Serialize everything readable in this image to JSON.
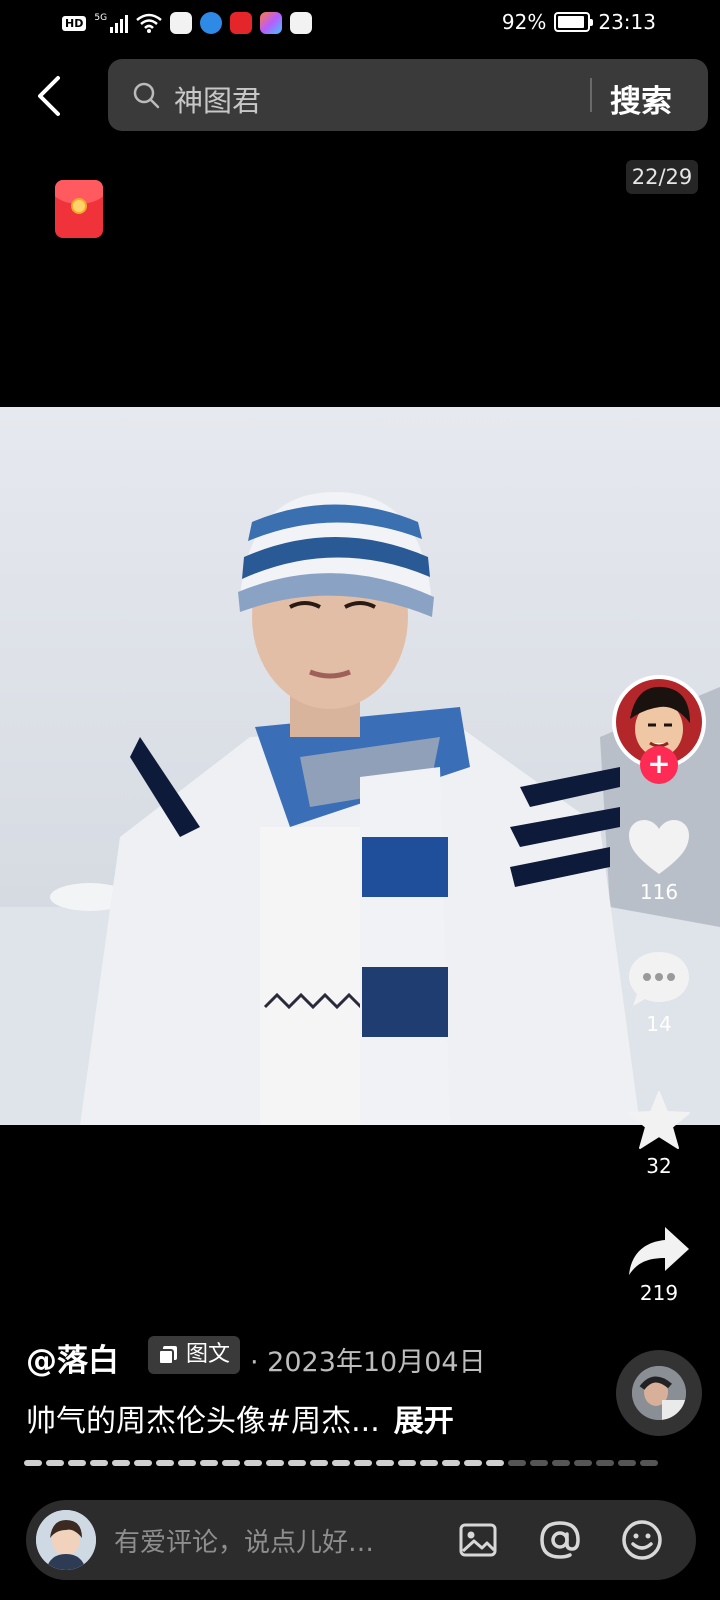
{
  "status_bar": {
    "left_badges": [
      "HD",
      "5G"
    ],
    "battery": "92%",
    "battery_level": 0.92,
    "time": "23:13"
  },
  "header": {
    "back_icon": "chevron-left-icon",
    "search_query": "神图君",
    "search_button": "搜索"
  },
  "image_counter": "22/29",
  "actions": {
    "likes": "116",
    "comments": "14",
    "favorites": "32",
    "shares": "219"
  },
  "post": {
    "author": "@落白",
    "type_tag": "图文",
    "date": "· 2023年10月04日",
    "caption": "帅气的周杰伦头像#周杰...",
    "expand": "展开"
  },
  "comment_bar": {
    "placeholder": "有爱评论，说点儿好…",
    "icons": [
      "image-icon",
      "at-icon",
      "emoji-icon"
    ]
  },
  "colors": {
    "accent": "#fe2c55",
    "search_bg": "#3a3a3a"
  }
}
